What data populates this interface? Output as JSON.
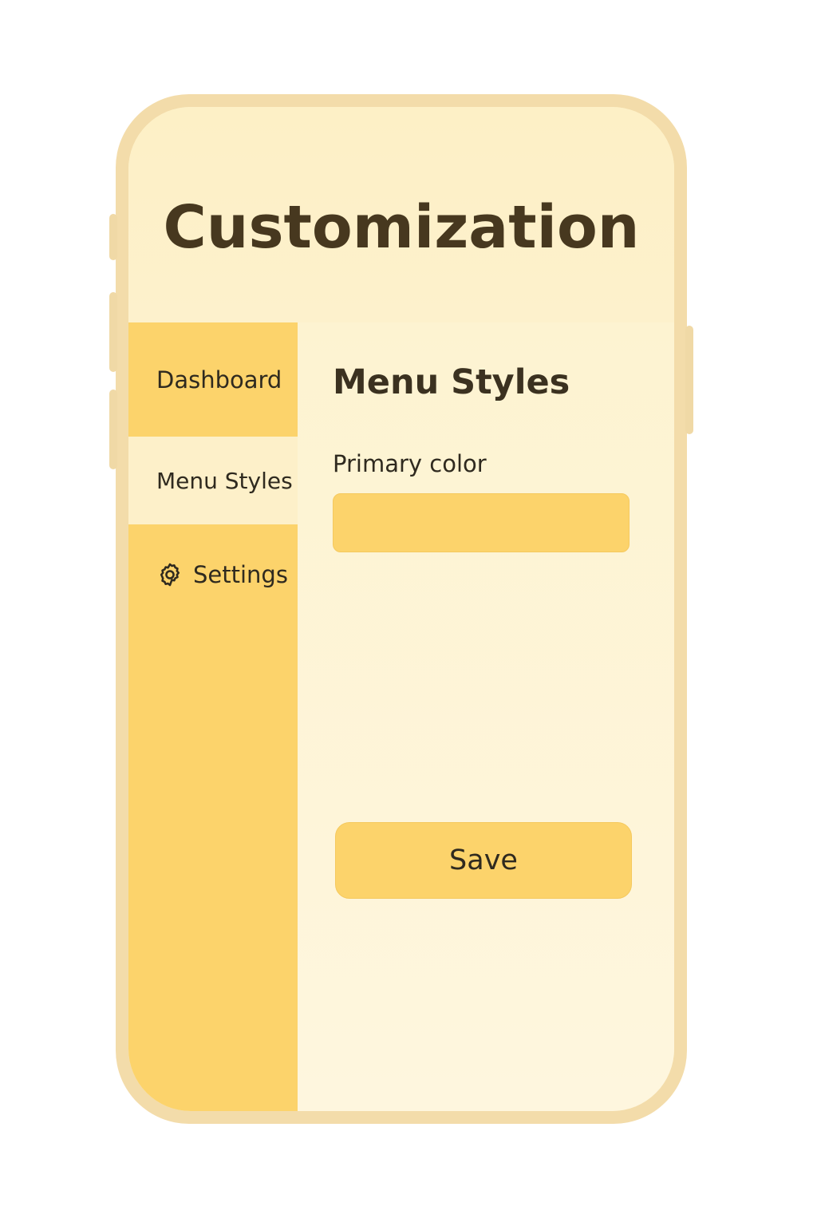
{
  "header": {
    "title": "Customization"
  },
  "sidebar": {
    "items": [
      {
        "label": "Dashboard",
        "icon": null,
        "active": false
      },
      {
        "label": "Menu Styles",
        "icon": null,
        "active": true
      },
      {
        "label": "Settings",
        "icon": "gear-icon",
        "active": false
      }
    ]
  },
  "main": {
    "section_title": "Menu Styles",
    "primary_color": {
      "label": "Primary color",
      "value_color": "#fcd36b"
    },
    "save_label": "Save"
  },
  "colors": {
    "accent": "#fcd36b",
    "background": "#fdf3cf",
    "frame": "#f3dcaa",
    "text": "#47381f"
  }
}
